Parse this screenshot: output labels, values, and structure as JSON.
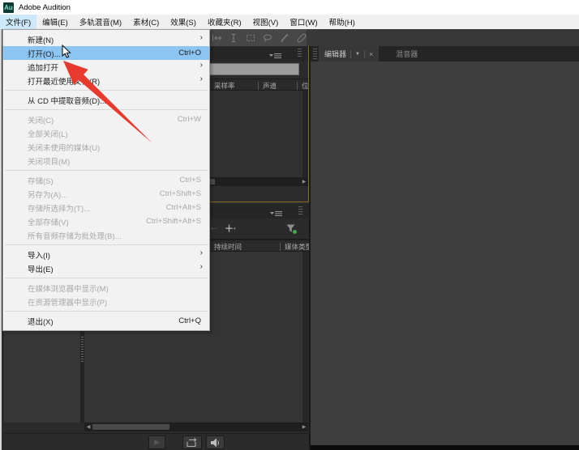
{
  "window": {
    "title": "Adobe Audition",
    "logo_text": "Au"
  },
  "menubar": {
    "items": [
      "文件(F)",
      "编辑(E)",
      "多轨混音(M)",
      "素材(C)",
      "效果(S)",
      "收藏夹(R)",
      "视图(V)",
      "窗口(W)",
      "帮助(H)"
    ],
    "active_item": "文件(F)"
  },
  "file_menu": {
    "items": [
      {
        "label": "新建(N)",
        "submenu": true
      },
      {
        "label": "打开(O)...",
        "shortcut": "Ctrl+O",
        "highlighted": true
      },
      {
        "label": "追加打开",
        "submenu": true
      },
      {
        "label": "打开最近使用文件(R)",
        "submenu": true
      },
      {
        "label": "从 CD 中提取音频(D)..."
      },
      {
        "label": "关闭(C)",
        "shortcut": "Ctrl+W",
        "disabled": true
      },
      {
        "label": "全部关闭(L)",
        "disabled": true
      },
      {
        "label": "关闭未使用的媒体(U)",
        "disabled": true
      },
      {
        "label": "关闭项目(M)",
        "disabled": true
      },
      {
        "label": "存储(S)",
        "shortcut": "Ctrl+S",
        "disabled": true
      },
      {
        "label": "另存为(A)...",
        "shortcut": "Ctrl+Shift+S",
        "disabled": true
      },
      {
        "label": "存储所选择为(T)...",
        "shortcut": "Ctrl+Alt+S",
        "disabled": true
      },
      {
        "label": "全部存储(V)",
        "shortcut": "Ctrl+Shift+Alt+S",
        "disabled": true
      },
      {
        "label": "所有音频存储为批处理(B)...",
        "disabled": true
      },
      {
        "label": "导入(I)",
        "submenu": true
      },
      {
        "label": "导出(E)",
        "submenu": true
      },
      {
        "label": "在媒体浏览器中显示(M)",
        "disabled": true
      },
      {
        "label": "在资源管理器中显示(P)",
        "disabled": true
      },
      {
        "label": "退出(X)",
        "shortcut": "Ctrl+Q"
      }
    ]
  },
  "toolbar": {
    "tools": [
      "slip-tool",
      "time-selection-tool",
      "marquee-selection-tool",
      "lasso-selection-tool",
      "paintbrush-tool",
      "spot-healing-brush-tool"
    ]
  },
  "files_panel": {
    "columns": [
      "采样率",
      "声道",
      "位"
    ],
    "search_value": ""
  },
  "media_browser": {
    "columns": [
      "持续时间",
      "媒体类型"
    ],
    "toolbar_icons": [
      "back-icon",
      "add-icon",
      "filter-icon"
    ],
    "transport_icons": [
      "play-icon",
      "loop-icon",
      "auto-play-speaker-icon"
    ]
  },
  "editor_dock": {
    "tabs": [
      {
        "label": "编辑器",
        "active": true,
        "closable": true
      },
      {
        "label": "混音器",
        "active": false
      }
    ]
  },
  "glyphs": {
    "submenu_arrow": "›",
    "dropdown": "▼",
    "close": "×",
    "back": "←",
    "plus": "＋",
    "plus_dd": "▾",
    "play": "▶",
    "scroll_left": "◀",
    "scroll_right": "▶"
  },
  "colors": {
    "menu_highlight": "#8cc4f2",
    "menubar_highlight": "#cde8fa",
    "focus_border": "#8a6c20",
    "annotation_red": "#e8392e",
    "logo_bg": "#0d3b33",
    "logo_text": "#7ce0c3"
  }
}
